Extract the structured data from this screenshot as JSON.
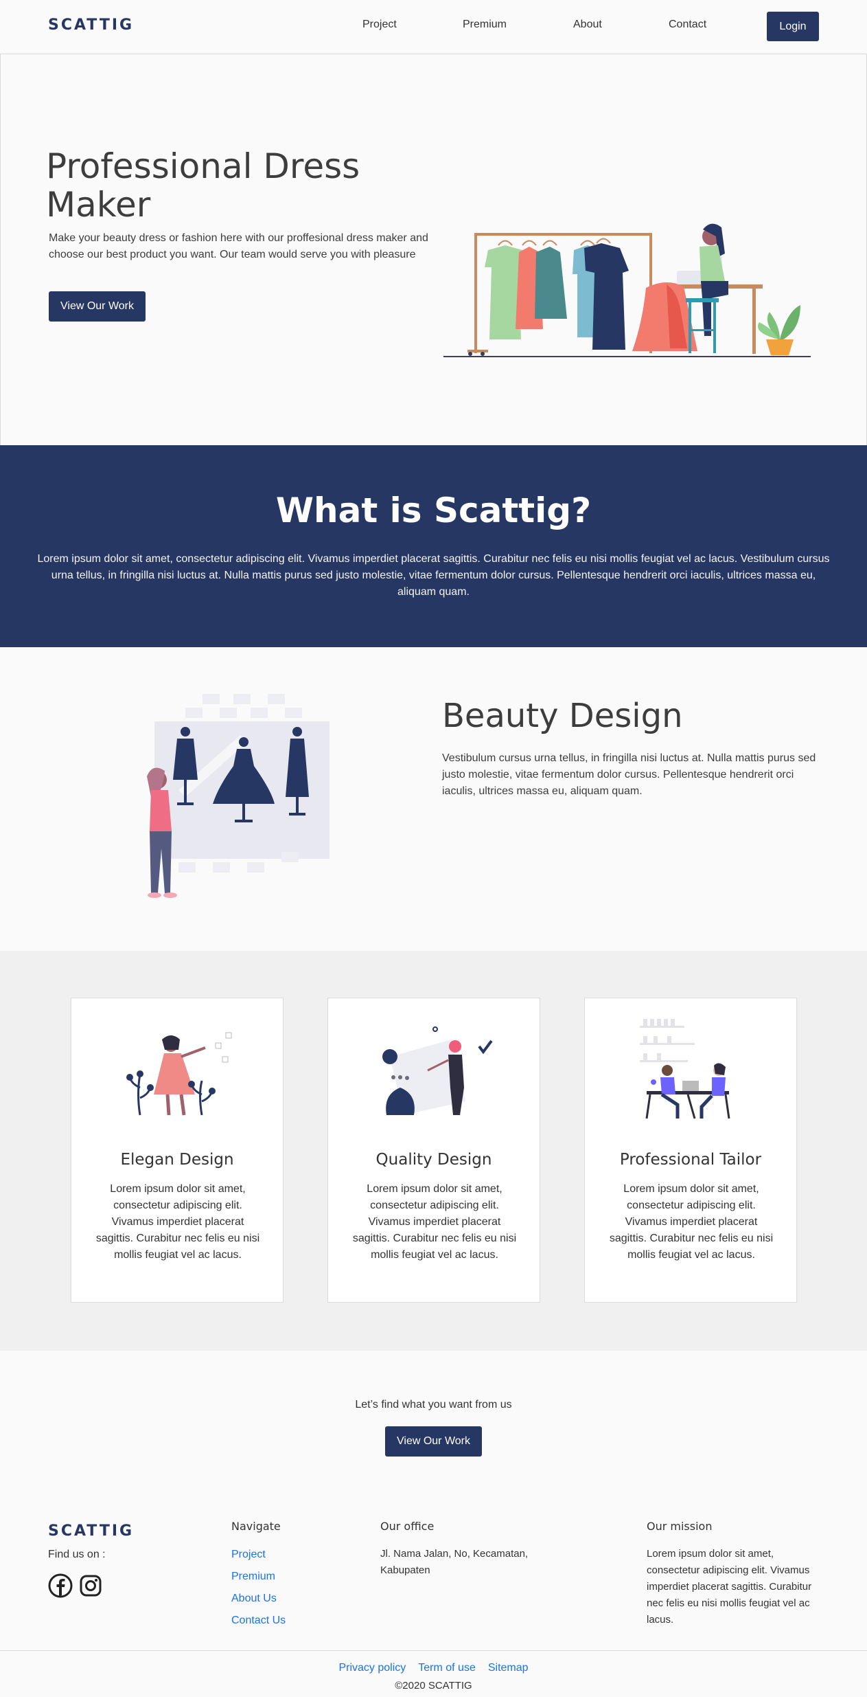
{
  "nav": {
    "logo": "SCATTIG",
    "links": [
      "Project",
      "Premium",
      "About",
      "Contact"
    ],
    "login": "Login"
  },
  "hero": {
    "title": "Professional Dress Maker",
    "description": "Make your beauty dress or fashion here with our proffesional dress maker and choose our best product you want. Our team would serve you with pleasure",
    "button": "View Our Work"
  },
  "what": {
    "title": "What is Scattig?",
    "text": "Lorem ipsum dolor sit amet, consectetur adipiscing elit. Vivamus imperdiet placerat sagittis. Curabitur nec felis eu nisi mollis feugiat vel ac lacus. Vestibulum cursus urna tellus, in fringilla nisi luctus at. Nulla mattis purus sed justo molestie, vitae fermentum dolor cursus. Pellentesque hendrerit orci iaculis, ultrices massa eu, aliquam quam."
  },
  "beauty": {
    "title": "Beauty Design",
    "text": "Vestibulum cursus urna tellus, in fringilla nisi luctus at. Nulla mattis purus sed justo molestie, vitae fermentum dolor cursus. Pellentesque hendrerit orci iaculis, ultrices massa eu, aliquam quam."
  },
  "features": [
    {
      "title": "Elegan Design",
      "text": "Lorem ipsum dolor sit amet, consectetur adipiscing elit. Vivamus imperdiet placerat sagittis. Curabitur nec felis eu nisi mollis feugiat vel ac lacus."
    },
    {
      "title": "Quality Design",
      "text": "Lorem ipsum dolor sit amet, consectetur adipiscing elit. Vivamus imperdiet placerat sagittis. Curabitur nec felis eu nisi mollis feugiat vel ac lacus."
    },
    {
      "title": "Professional Tailor",
      "text": "Lorem ipsum dolor sit amet, consectetur adipiscing elit. Vivamus imperdiet placerat sagittis. Curabitur nec felis eu nisi mollis feugiat vel ac lacus."
    }
  ],
  "cta": {
    "text": "Let’s find what you want from us",
    "button": "View Our Work"
  },
  "footer": {
    "logo": "SCATTIG",
    "find_us": "Find us on :",
    "social_icons": [
      "facebook-icon",
      "instagram-icon"
    ],
    "navigate": {
      "title": "Navigate",
      "links": [
        "Project",
        "Premium",
        "About Us",
        "Contact Us"
      ]
    },
    "office": {
      "title": "Our office",
      "text": "Jl. Nama Jalan, No, Kecamatan, Kabupaten"
    },
    "mission": {
      "title": "Our mission",
      "text": "Lorem ipsum dolor sit amet, consectetur adipiscing elit. Vivamus imperdiet placerat sagittis. Curabitur nec felis eu nisi mollis feugiat vel ac lacus."
    }
  },
  "bottom": {
    "links": [
      "Privacy policy",
      "Term of use",
      "Sitemap"
    ],
    "copyright": "©2020 SCATTIG"
  },
  "colors": {
    "primary": "#263763",
    "link": "#1a73e8",
    "feature_bg": "#f0f0f0"
  }
}
